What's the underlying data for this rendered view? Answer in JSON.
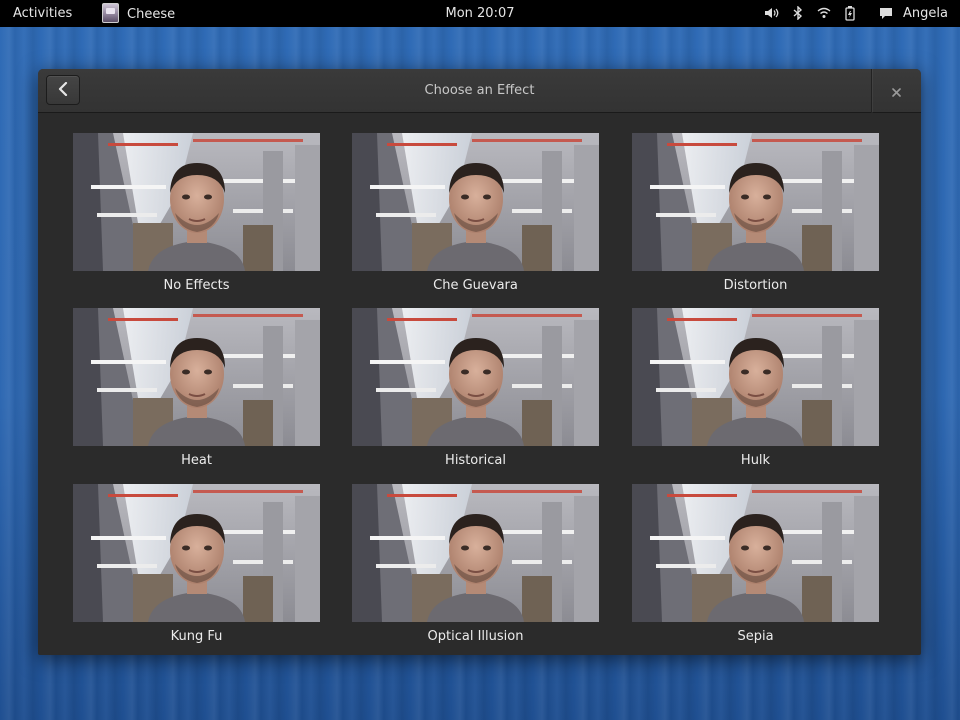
{
  "topbar": {
    "activities": "Activities",
    "app_name": "Cheese",
    "clock": "Mon 20:07",
    "user": "Angela",
    "tray_icons": [
      "volume-icon",
      "bluetooth-icon",
      "wifi-icon",
      "battery-icon",
      "chat-icon"
    ]
  },
  "dialog": {
    "title": "Choose an Effect",
    "back_icon": "chevron-left-icon",
    "close_icon": "close-icon"
  },
  "effects": [
    {
      "label": "No Effects"
    },
    {
      "label": "Che Guevara"
    },
    {
      "label": "Distortion"
    },
    {
      "label": "Heat"
    },
    {
      "label": "Historical"
    },
    {
      "label": "Hulk"
    },
    {
      "label": "Kung Fu"
    },
    {
      "label": "Optical Illusion"
    },
    {
      "label": "Sepia"
    }
  ],
  "colors": {
    "topbar_bg": "#000000",
    "dialog_bg": "#2b2b2b",
    "desktop_blue": "#2f6bb6"
  }
}
